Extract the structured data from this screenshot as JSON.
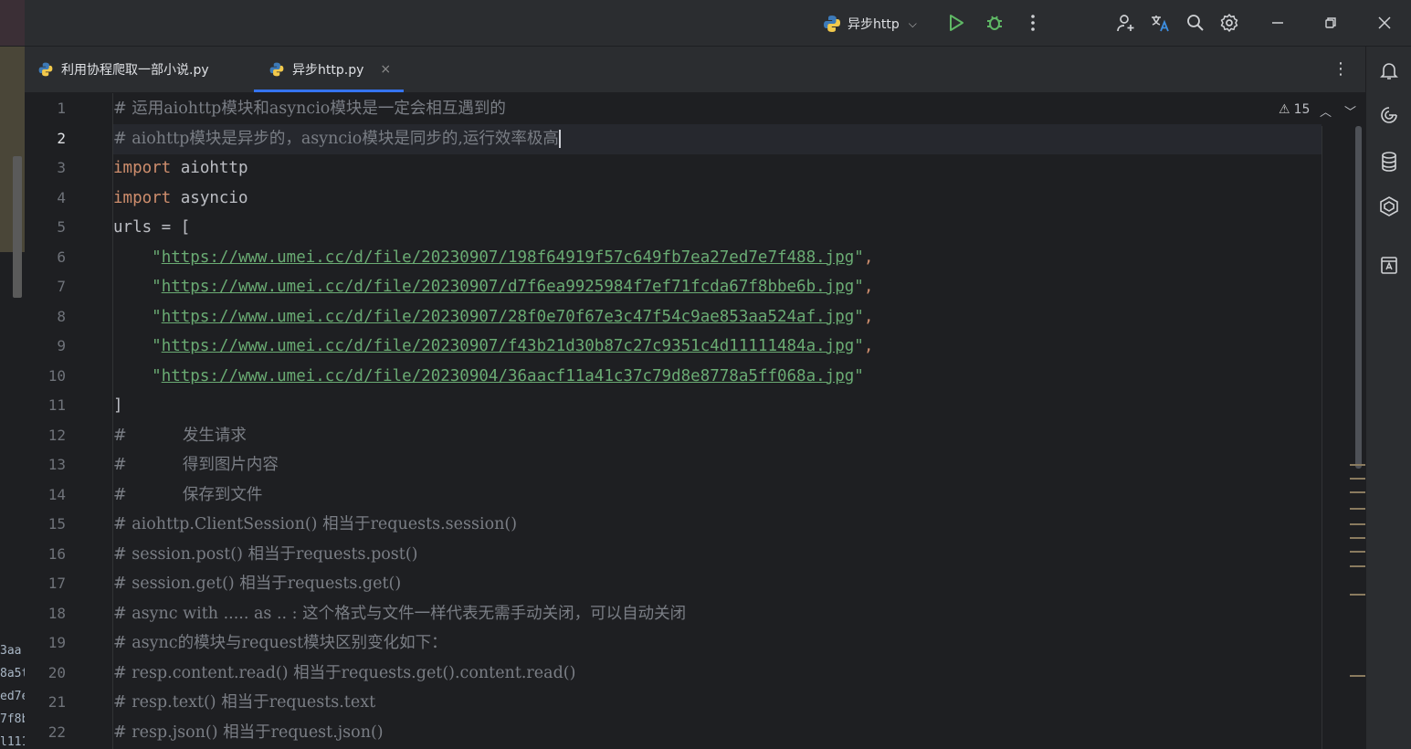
{
  "toolbar": {
    "run_config_label": "异步http"
  },
  "tabs": [
    {
      "label": "利用协程爬取一部小说.py",
      "active": false
    },
    {
      "label": "异步http.py",
      "active": true,
      "close": "×"
    }
  ],
  "editor": {
    "warning_count": "15",
    "line_numbers": [
      "1",
      "2",
      "3",
      "4",
      "5",
      "6",
      "7",
      "8",
      "9",
      "10",
      "11",
      "12",
      "13",
      "14",
      "15",
      "16",
      "17",
      "18",
      "19",
      "20",
      "21",
      "22"
    ],
    "current_line": 2,
    "lines": [
      {
        "segments": [
          {
            "cls": "cmt",
            "text": "# 运用aiohttp模块和asyncio模块是一定会相互遇到的"
          }
        ]
      },
      {
        "segments": [
          {
            "cls": "cmt",
            "text": "# aiohttp模块是异步的，asyncio模块是同步的,运行效率极高"
          }
        ]
      },
      {
        "segments": [
          {
            "cls": "kw",
            "text": "import"
          },
          {
            "cls": "id",
            "text": " aiohttp"
          }
        ]
      },
      {
        "segments": [
          {
            "cls": "kw",
            "text": "import"
          },
          {
            "cls": "id",
            "text": " asyncio"
          }
        ]
      },
      {
        "segments": [
          {
            "cls": "id",
            "text": "urls = ["
          }
        ]
      },
      {
        "segments": [
          {
            "cls": "str",
            "text": "    \""
          },
          {
            "cls": "url",
            "text": "https://www.umei.cc/d/file/20230907/198f64919f57c649fb7ea27ed7e7f488.jpg"
          },
          {
            "cls": "str",
            "text": "\""
          },
          {
            "cls": "kw",
            "text": ","
          }
        ]
      },
      {
        "segments": [
          {
            "cls": "str",
            "text": "    \""
          },
          {
            "cls": "url",
            "text": "https://www.umei.cc/d/file/20230907/d7f6ea9925984f7ef71fcda67f8bbe6b.jpg"
          },
          {
            "cls": "str",
            "text": "\""
          },
          {
            "cls": "kw",
            "text": ","
          }
        ]
      },
      {
        "segments": [
          {
            "cls": "str",
            "text": "    \""
          },
          {
            "cls": "url",
            "text": "https://www.umei.cc/d/file/20230907/28f0e70f67e3c47f54c9ae853aa524af.jpg"
          },
          {
            "cls": "str",
            "text": "\""
          },
          {
            "cls": "kw",
            "text": ","
          }
        ]
      },
      {
        "segments": [
          {
            "cls": "str",
            "text": "    \""
          },
          {
            "cls": "url",
            "text": "https://www.umei.cc/d/file/20230907/f43b21d30b87c27c9351c4d11111484a.jpg"
          },
          {
            "cls": "str",
            "text": "\""
          },
          {
            "cls": "kw",
            "text": ","
          }
        ]
      },
      {
        "segments": [
          {
            "cls": "str",
            "text": "    \""
          },
          {
            "cls": "url",
            "text": "https://www.umei.cc/d/file/20230904/36aacf11a41c37c79d8e8778a5ff068a.jpg"
          },
          {
            "cls": "str",
            "text": "\""
          }
        ]
      },
      {
        "segments": [
          {
            "cls": "id",
            "text": "]"
          }
        ]
      },
      {
        "segments": [
          {
            "cls": "cmt",
            "text": "#           发生请求"
          }
        ]
      },
      {
        "segments": [
          {
            "cls": "cmt",
            "text": "#           得到图片内容"
          }
        ]
      },
      {
        "segments": [
          {
            "cls": "cmt",
            "text": "#           保存到文件"
          }
        ]
      },
      {
        "segments": [
          {
            "cls": "cmt",
            "text": "# aiohttp.ClientSession() 相当于requests.session()"
          }
        ]
      },
      {
        "segments": [
          {
            "cls": "cmt",
            "text": "# session.post() 相当于requests.post()"
          }
        ]
      },
      {
        "segments": [
          {
            "cls": "cmt",
            "text": "# session.get() 相当于requests.get()"
          }
        ]
      },
      {
        "segments": [
          {
            "cls": "cmt",
            "text": "# async with ..... as .. : 这个格式与文件一样代表无需手动关闭，可以自动关闭"
          }
        ]
      },
      {
        "segments": [
          {
            "cls": "cmt",
            "text": "# async的模块与request模块区别变化如下："
          }
        ]
      },
      {
        "segments": [
          {
            "cls": "cmt",
            "text": "# resp.content.read() 相当于requests.get().content.read()"
          }
        ]
      },
      {
        "segments": [
          {
            "cls": "cmt",
            "text": "# resp.text() 相当于requests.text"
          }
        ]
      },
      {
        "segments": [
          {
            "cls": "cmt",
            "text": "# resp.json() 相当于request.json()"
          }
        ]
      }
    ]
  },
  "left_strip_text": [
    "3aa",
    "8a5t",
    "ed7e",
    "7f8b",
    "l111"
  ],
  "colors": {
    "accent": "#3574f0",
    "run_green": "#5fb865",
    "debug_green": "#5fb865"
  }
}
